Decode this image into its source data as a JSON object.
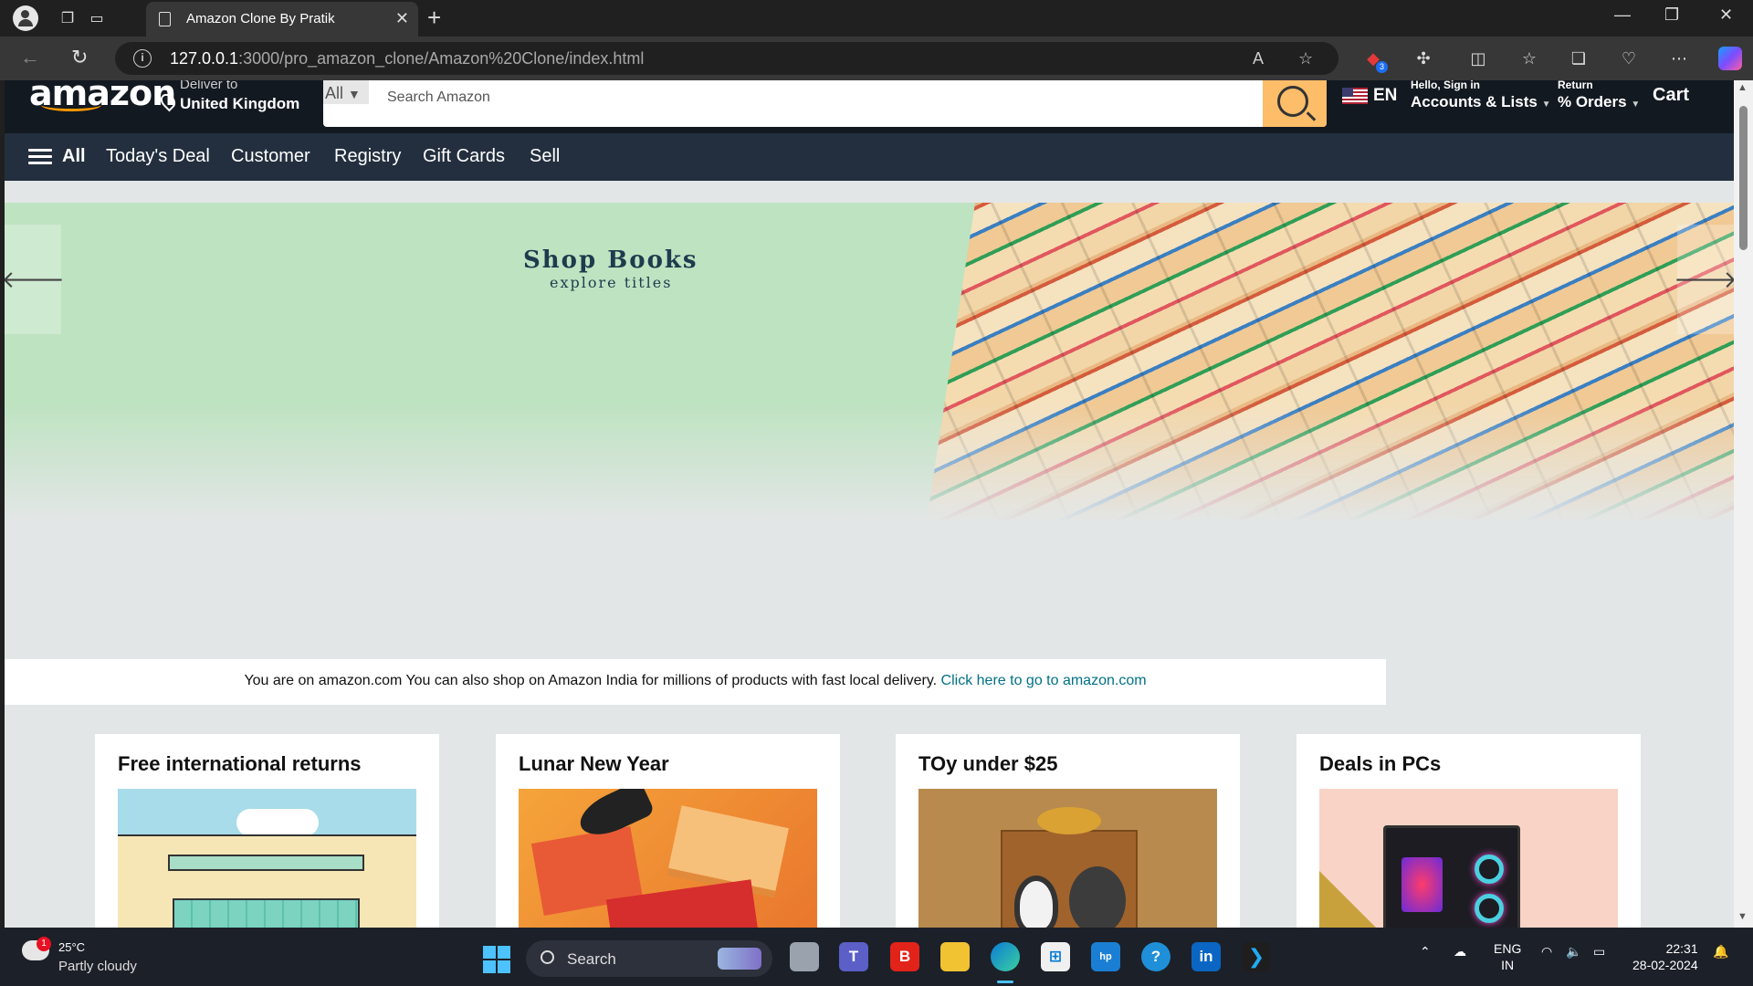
{
  "browser": {
    "tab_title": "Amazon Clone By Pratik",
    "url_host": "127.0.0.1",
    "url_path": ":3000/pro_amazon_clone/Amazon%20Clone/index.html",
    "extension_badge": "3"
  },
  "header": {
    "logo": "amazon",
    "deliver_label": "Deliver to",
    "deliver_location": "United Kingdom",
    "search_category": "All",
    "search_placeholder": "Search Amazon",
    "language": "EN",
    "account_greeting": "Hello, Sign in",
    "account_label": "Accounts & Lists",
    "returns_label": "Return",
    "orders_label": "% Orders",
    "cart_label": "Cart"
  },
  "subnav": {
    "all_label": "All",
    "items": [
      "Today's Deal",
      "Customer",
      "Registry",
      "Gift Cards",
      "Sell"
    ]
  },
  "banner": {
    "title": "Shop Books",
    "subtitle": "explore titles"
  },
  "notice": {
    "text": "You are on amazon.com You can also shop on Amazon India for millions of products with fast local delivery.",
    "link": "Click here to go to amazon.com"
  },
  "cards": [
    {
      "title": "Free international returns"
    },
    {
      "title": "Lunar New Year"
    },
    {
      "title": "TOy under $25"
    },
    {
      "title": "Deals in PCs"
    }
  ],
  "taskbar": {
    "weather_badge": "1",
    "weather_temp": "25°C",
    "weather_desc": "Partly cloudy",
    "search_label": "Search",
    "lang_top": "ENG",
    "lang_bottom": "IN",
    "time": "22:31",
    "date": "28-02-2024"
  },
  "colors": {
    "amazon_header": "#131921",
    "amazon_subnav": "#232f3e",
    "search_button": "#febd69",
    "link": "#007185",
    "banner_bg": "#bee3c1"
  }
}
